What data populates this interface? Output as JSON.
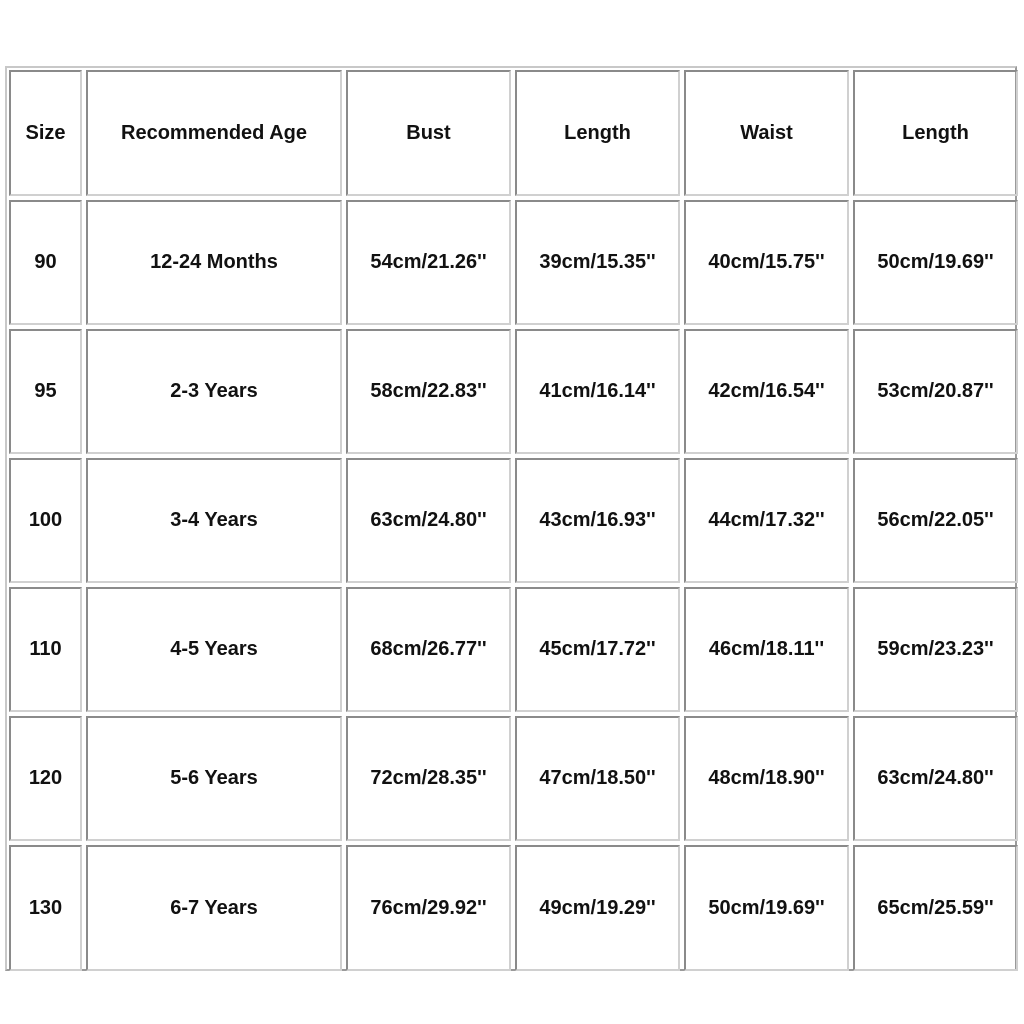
{
  "table": {
    "headers": [
      "Size",
      "Recommended Age",
      "Bust",
      "Length",
      "Waist",
      "Length"
    ],
    "rows": [
      [
        "90",
        "12-24 Months",
        "54cm/21.26''",
        "39cm/15.35''",
        "40cm/15.75''",
        "50cm/19.69''"
      ],
      [
        "95",
        "2-3 Years",
        "58cm/22.83''",
        "41cm/16.14''",
        "42cm/16.54''",
        "53cm/20.87''"
      ],
      [
        "100",
        "3-4 Years",
        "63cm/24.80''",
        "43cm/16.93''",
        "44cm/17.32''",
        "56cm/22.05''"
      ],
      [
        "110",
        "4-5 Years",
        "68cm/26.77''",
        "45cm/17.72''",
        "46cm/18.11''",
        "59cm/23.23''"
      ],
      [
        "120",
        "5-6 Years",
        "72cm/28.35''",
        "47cm/18.50''",
        "48cm/18.90''",
        "63cm/24.80''"
      ],
      [
        "130",
        "6-7 Years",
        "76cm/29.92''",
        "49cm/19.29''",
        "50cm/19.69''",
        "65cm/25.59''"
      ]
    ]
  }
}
